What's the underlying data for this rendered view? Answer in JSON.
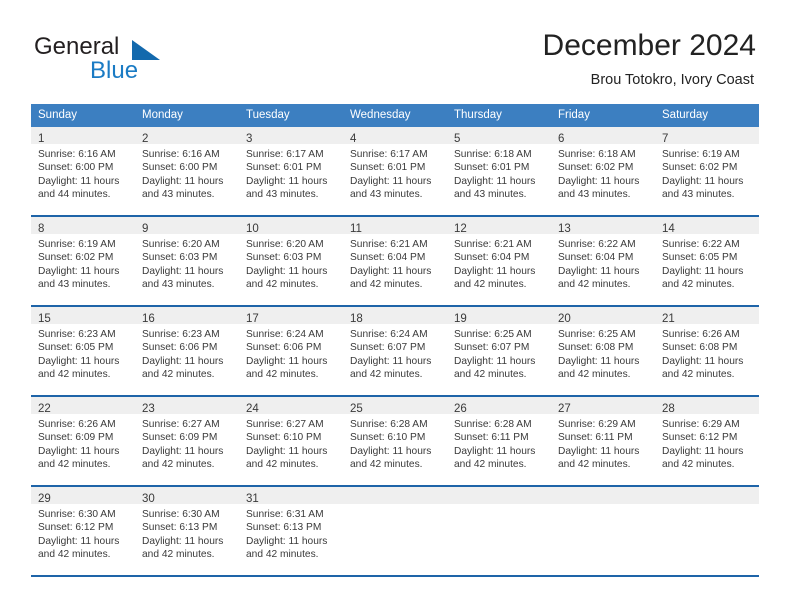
{
  "brand": {
    "name_part1": "General",
    "name_part2": "Blue",
    "accent_color": "#1369ad"
  },
  "header": {
    "title": "December 2024",
    "subtitle": "Brou Totokro, Ivory Coast"
  },
  "theme": {
    "header_row_bg": "#3c7fc1",
    "row_rule": "#1e64a8",
    "daynum_band_bg": "#efefef",
    "text": "#3a3a3a"
  },
  "weekday_headers": [
    "Sunday",
    "Monday",
    "Tuesday",
    "Wednesday",
    "Thursday",
    "Friday",
    "Saturday"
  ],
  "weeks": [
    [
      {
        "day": "1",
        "sunrise": "Sunrise: 6:16 AM",
        "sunset": "Sunset: 6:00 PM",
        "daylight1": "Daylight: 11 hours",
        "daylight2": "and 44 minutes."
      },
      {
        "day": "2",
        "sunrise": "Sunrise: 6:16 AM",
        "sunset": "Sunset: 6:00 PM",
        "daylight1": "Daylight: 11 hours",
        "daylight2": "and 43 minutes."
      },
      {
        "day": "3",
        "sunrise": "Sunrise: 6:17 AM",
        "sunset": "Sunset: 6:01 PM",
        "daylight1": "Daylight: 11 hours",
        "daylight2": "and 43 minutes."
      },
      {
        "day": "4",
        "sunrise": "Sunrise: 6:17 AM",
        "sunset": "Sunset: 6:01 PM",
        "daylight1": "Daylight: 11 hours",
        "daylight2": "and 43 minutes."
      },
      {
        "day": "5",
        "sunrise": "Sunrise: 6:18 AM",
        "sunset": "Sunset: 6:01 PM",
        "daylight1": "Daylight: 11 hours",
        "daylight2": "and 43 minutes."
      },
      {
        "day": "6",
        "sunrise": "Sunrise: 6:18 AM",
        "sunset": "Sunset: 6:02 PM",
        "daylight1": "Daylight: 11 hours",
        "daylight2": "and 43 minutes."
      },
      {
        "day": "7",
        "sunrise": "Sunrise: 6:19 AM",
        "sunset": "Sunset: 6:02 PM",
        "daylight1": "Daylight: 11 hours",
        "daylight2": "and 43 minutes."
      }
    ],
    [
      {
        "day": "8",
        "sunrise": "Sunrise: 6:19 AM",
        "sunset": "Sunset: 6:02 PM",
        "daylight1": "Daylight: 11 hours",
        "daylight2": "and 43 minutes."
      },
      {
        "day": "9",
        "sunrise": "Sunrise: 6:20 AM",
        "sunset": "Sunset: 6:03 PM",
        "daylight1": "Daylight: 11 hours",
        "daylight2": "and 43 minutes."
      },
      {
        "day": "10",
        "sunrise": "Sunrise: 6:20 AM",
        "sunset": "Sunset: 6:03 PM",
        "daylight1": "Daylight: 11 hours",
        "daylight2": "and 42 minutes."
      },
      {
        "day": "11",
        "sunrise": "Sunrise: 6:21 AM",
        "sunset": "Sunset: 6:04 PM",
        "daylight1": "Daylight: 11 hours",
        "daylight2": "and 42 minutes."
      },
      {
        "day": "12",
        "sunrise": "Sunrise: 6:21 AM",
        "sunset": "Sunset: 6:04 PM",
        "daylight1": "Daylight: 11 hours",
        "daylight2": "and 42 minutes."
      },
      {
        "day": "13",
        "sunrise": "Sunrise: 6:22 AM",
        "sunset": "Sunset: 6:04 PM",
        "daylight1": "Daylight: 11 hours",
        "daylight2": "and 42 minutes."
      },
      {
        "day": "14",
        "sunrise": "Sunrise: 6:22 AM",
        "sunset": "Sunset: 6:05 PM",
        "daylight1": "Daylight: 11 hours",
        "daylight2": "and 42 minutes."
      }
    ],
    [
      {
        "day": "15",
        "sunrise": "Sunrise: 6:23 AM",
        "sunset": "Sunset: 6:05 PM",
        "daylight1": "Daylight: 11 hours",
        "daylight2": "and 42 minutes."
      },
      {
        "day": "16",
        "sunrise": "Sunrise: 6:23 AM",
        "sunset": "Sunset: 6:06 PM",
        "daylight1": "Daylight: 11 hours",
        "daylight2": "and 42 minutes."
      },
      {
        "day": "17",
        "sunrise": "Sunrise: 6:24 AM",
        "sunset": "Sunset: 6:06 PM",
        "daylight1": "Daylight: 11 hours",
        "daylight2": "and 42 minutes."
      },
      {
        "day": "18",
        "sunrise": "Sunrise: 6:24 AM",
        "sunset": "Sunset: 6:07 PM",
        "daylight1": "Daylight: 11 hours",
        "daylight2": "and 42 minutes."
      },
      {
        "day": "19",
        "sunrise": "Sunrise: 6:25 AM",
        "sunset": "Sunset: 6:07 PM",
        "daylight1": "Daylight: 11 hours",
        "daylight2": "and 42 minutes."
      },
      {
        "day": "20",
        "sunrise": "Sunrise: 6:25 AM",
        "sunset": "Sunset: 6:08 PM",
        "daylight1": "Daylight: 11 hours",
        "daylight2": "and 42 minutes."
      },
      {
        "day": "21",
        "sunrise": "Sunrise: 6:26 AM",
        "sunset": "Sunset: 6:08 PM",
        "daylight1": "Daylight: 11 hours",
        "daylight2": "and 42 minutes."
      }
    ],
    [
      {
        "day": "22",
        "sunrise": "Sunrise: 6:26 AM",
        "sunset": "Sunset: 6:09 PM",
        "daylight1": "Daylight: 11 hours",
        "daylight2": "and 42 minutes."
      },
      {
        "day": "23",
        "sunrise": "Sunrise: 6:27 AM",
        "sunset": "Sunset: 6:09 PM",
        "daylight1": "Daylight: 11 hours",
        "daylight2": "and 42 minutes."
      },
      {
        "day": "24",
        "sunrise": "Sunrise: 6:27 AM",
        "sunset": "Sunset: 6:10 PM",
        "daylight1": "Daylight: 11 hours",
        "daylight2": "and 42 minutes."
      },
      {
        "day": "25",
        "sunrise": "Sunrise: 6:28 AM",
        "sunset": "Sunset: 6:10 PM",
        "daylight1": "Daylight: 11 hours",
        "daylight2": "and 42 minutes."
      },
      {
        "day": "26",
        "sunrise": "Sunrise: 6:28 AM",
        "sunset": "Sunset: 6:11 PM",
        "daylight1": "Daylight: 11 hours",
        "daylight2": "and 42 minutes."
      },
      {
        "day": "27",
        "sunrise": "Sunrise: 6:29 AM",
        "sunset": "Sunset: 6:11 PM",
        "daylight1": "Daylight: 11 hours",
        "daylight2": "and 42 minutes."
      },
      {
        "day": "28",
        "sunrise": "Sunrise: 6:29 AM",
        "sunset": "Sunset: 6:12 PM",
        "daylight1": "Daylight: 11 hours",
        "daylight2": "and 42 minutes."
      }
    ],
    [
      {
        "day": "29",
        "sunrise": "Sunrise: 6:30 AM",
        "sunset": "Sunset: 6:12 PM",
        "daylight1": "Daylight: 11 hours",
        "daylight2": "and 42 minutes."
      },
      {
        "day": "30",
        "sunrise": "Sunrise: 6:30 AM",
        "sunset": "Sunset: 6:13 PM",
        "daylight1": "Daylight: 11 hours",
        "daylight2": "and 42 minutes."
      },
      {
        "day": "31",
        "sunrise": "Sunrise: 6:31 AM",
        "sunset": "Sunset: 6:13 PM",
        "daylight1": "Daylight: 11 hours",
        "daylight2": "and 42 minutes."
      },
      {
        "day": "",
        "sunrise": "",
        "sunset": "",
        "daylight1": "",
        "daylight2": ""
      },
      {
        "day": "",
        "sunrise": "",
        "sunset": "",
        "daylight1": "",
        "daylight2": ""
      },
      {
        "day": "",
        "sunrise": "",
        "sunset": "",
        "daylight1": "",
        "daylight2": ""
      },
      {
        "day": "",
        "sunrise": "",
        "sunset": "",
        "daylight1": "",
        "daylight2": ""
      }
    ]
  ]
}
